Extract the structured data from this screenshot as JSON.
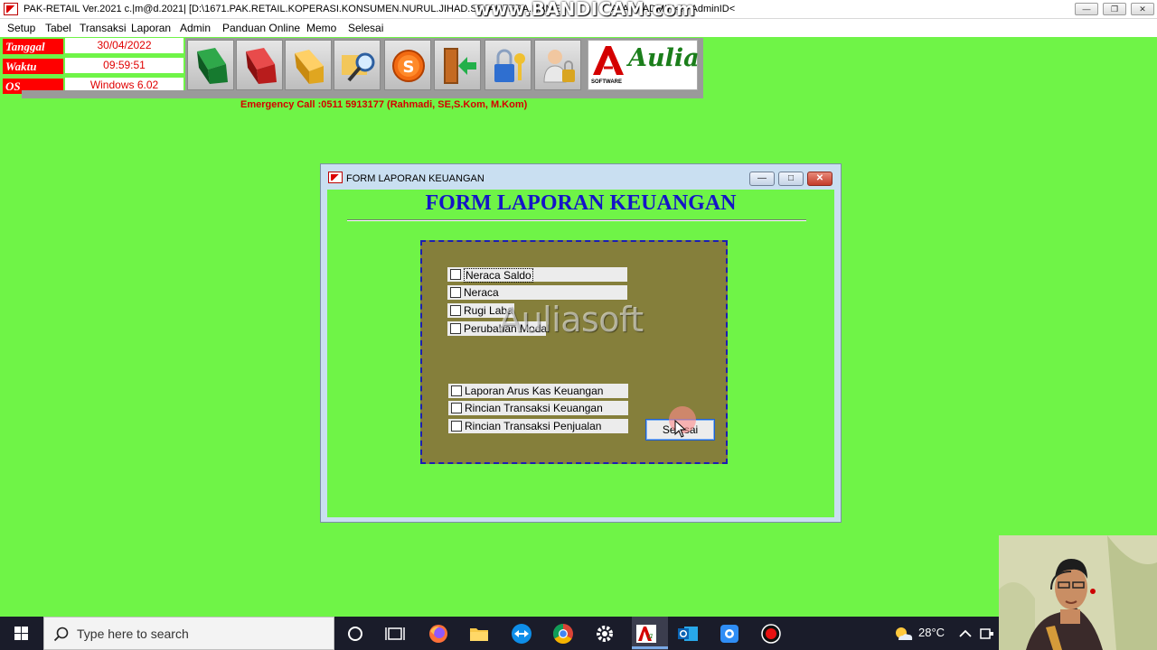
{
  "window": {
    "title": "PAK-RETAIL Ver.2021 c.|m@d.2021| [D:\\1671.PAK.RETAIL.KOPERASI.KONSUMEN.NURUL.JIHAD.SEJAHTERA.RAME",
    "title_tail": "ATA] > ADMIN<!> AdminID<",
    "recording_watermark": "www.BANDICAM.com"
  },
  "menu": [
    "Setup",
    "Tabel",
    "Transaksi",
    "Laporan",
    "Admin",
    "Panduan Online",
    "Memo",
    "Selesai"
  ],
  "info": {
    "tanggal_label": "Tanggal",
    "tanggal_value": "30/04/2022",
    "waktu_label": "Waktu",
    "waktu_value": "09:59:51",
    "os_label": "OS",
    "os_value": "Windows 6.02"
  },
  "logo": {
    "brand": "Aulia",
    "tag": "SOFTWARE"
  },
  "emergency": "Emergency Call :0511 5913177 (Rahmadi, SE,S.Kom, M.Kom)",
  "dialog": {
    "title": "FORM LAPORAN KEUANGAN",
    "heading": "FORM LAPORAN KEUANGAN",
    "options_top": [
      "Neraca Saldo",
      "Neraca",
      "Rugi Laba",
      "Perubahan Modal"
    ],
    "options_bottom": [
      "Laporan Arus Kas Keuangan",
      "Rincian Transaksi Keuangan",
      "Rincian Transaksi Penjualan"
    ],
    "selesai_label": "Selesai"
  },
  "overlay_watermark": "Auliasoft",
  "taskbar": {
    "search_placeholder": "Type here to search",
    "temperature": "28°C"
  },
  "colors": {
    "background": "#6ff447",
    "info_label": "#ff0000",
    "form_heading": "#1414c8",
    "panel": "#857f3b",
    "emergency": "#d40000"
  }
}
